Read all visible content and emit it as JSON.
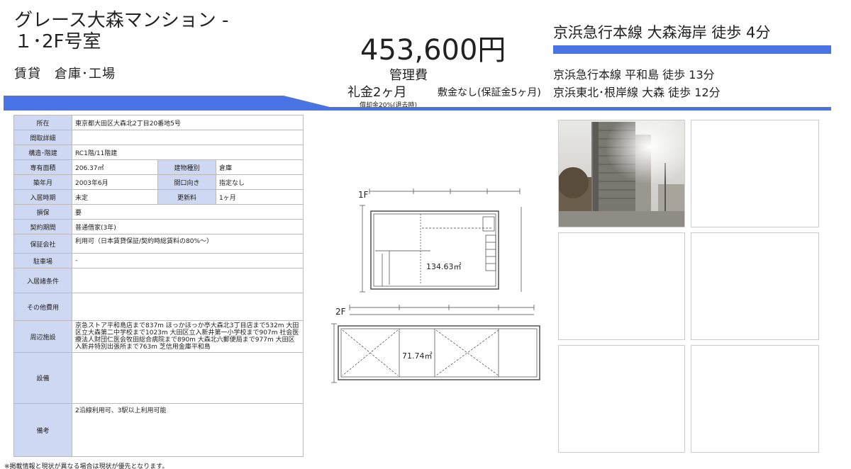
{
  "header": {
    "title": "グレース大森マンション - １･2F号室",
    "subtitle": "賃貸　倉庫･工場",
    "price": "453,600円",
    "management_fee": "管理費",
    "key_money": "礼金2ヶ月",
    "deposit": "敷金なし(保証金5ヶ月)",
    "amortization": "償却金20%(退去時)"
  },
  "stations": {
    "main": "京浜急行本線 大森海岸 徒歩 4分",
    "sub1": "京浜急行本線 平和島 徒歩 13分",
    "sub2": "京浜東北･根岸線 大森 徒歩 12分"
  },
  "table": {
    "location_label": "所在",
    "location": "東京都大田区大森北2丁目20番地5号",
    "layout_label": "間取詳細",
    "layout": "",
    "structure_label": "構造･階建",
    "structure": "RC1階/11階建",
    "area_label": "専有面積",
    "area": "206.37㎡",
    "building_type_label": "建物種別",
    "building_type": "倉庫",
    "built_label": "築年月",
    "built": "2003年6月",
    "facing_label": "開口向き",
    "facing": "指定なし",
    "move_in_label": "入居時期",
    "move_in": "未定",
    "renewal_label": "更新料",
    "renewal": "1ヶ月",
    "insurance_label": "損保",
    "insurance": "要",
    "contract_label": "契約期間",
    "contract": "普通借家(3年)",
    "guarantor_label": "保証会社",
    "guarantor": "利用可（日本賃貸保証/契約時総賃料の80%～）",
    "parking_label": "駐車場",
    "parking": "-",
    "conditions_label": "入居諸条件",
    "conditions": "",
    "other_fees_label": "その他費用",
    "other_fees": "",
    "nearby_label": "周辺施設",
    "nearby": "京急ストア平和島店まで837m ほっかほっか亭大森北3丁目店まで532m 大田区立大森第二中学校まで1023m 大田区立入新井第一小学校まで907m 社会医療法人財団仁医会牧田総合病院まで890m 大森北六郵便局まで977m 大田区入新井特別出張所まで763m 芝信用金庫平和島",
    "equipment_label": "設備",
    "equipment": "",
    "remarks_label": "備考",
    "remarks": "2沿線利用可、3駅以上利用可能"
  },
  "footnote": "※掲載情報と現状が異なる場合は現状が優先となります。",
  "floorplan": {
    "floor1_label": "1F",
    "floor1_area": "134.63㎡",
    "floor2_label": "2F",
    "floor2_area": "71.74㎡"
  },
  "colors": {
    "accent": "#4a74e6",
    "label_bg": "#cfd8f2"
  }
}
